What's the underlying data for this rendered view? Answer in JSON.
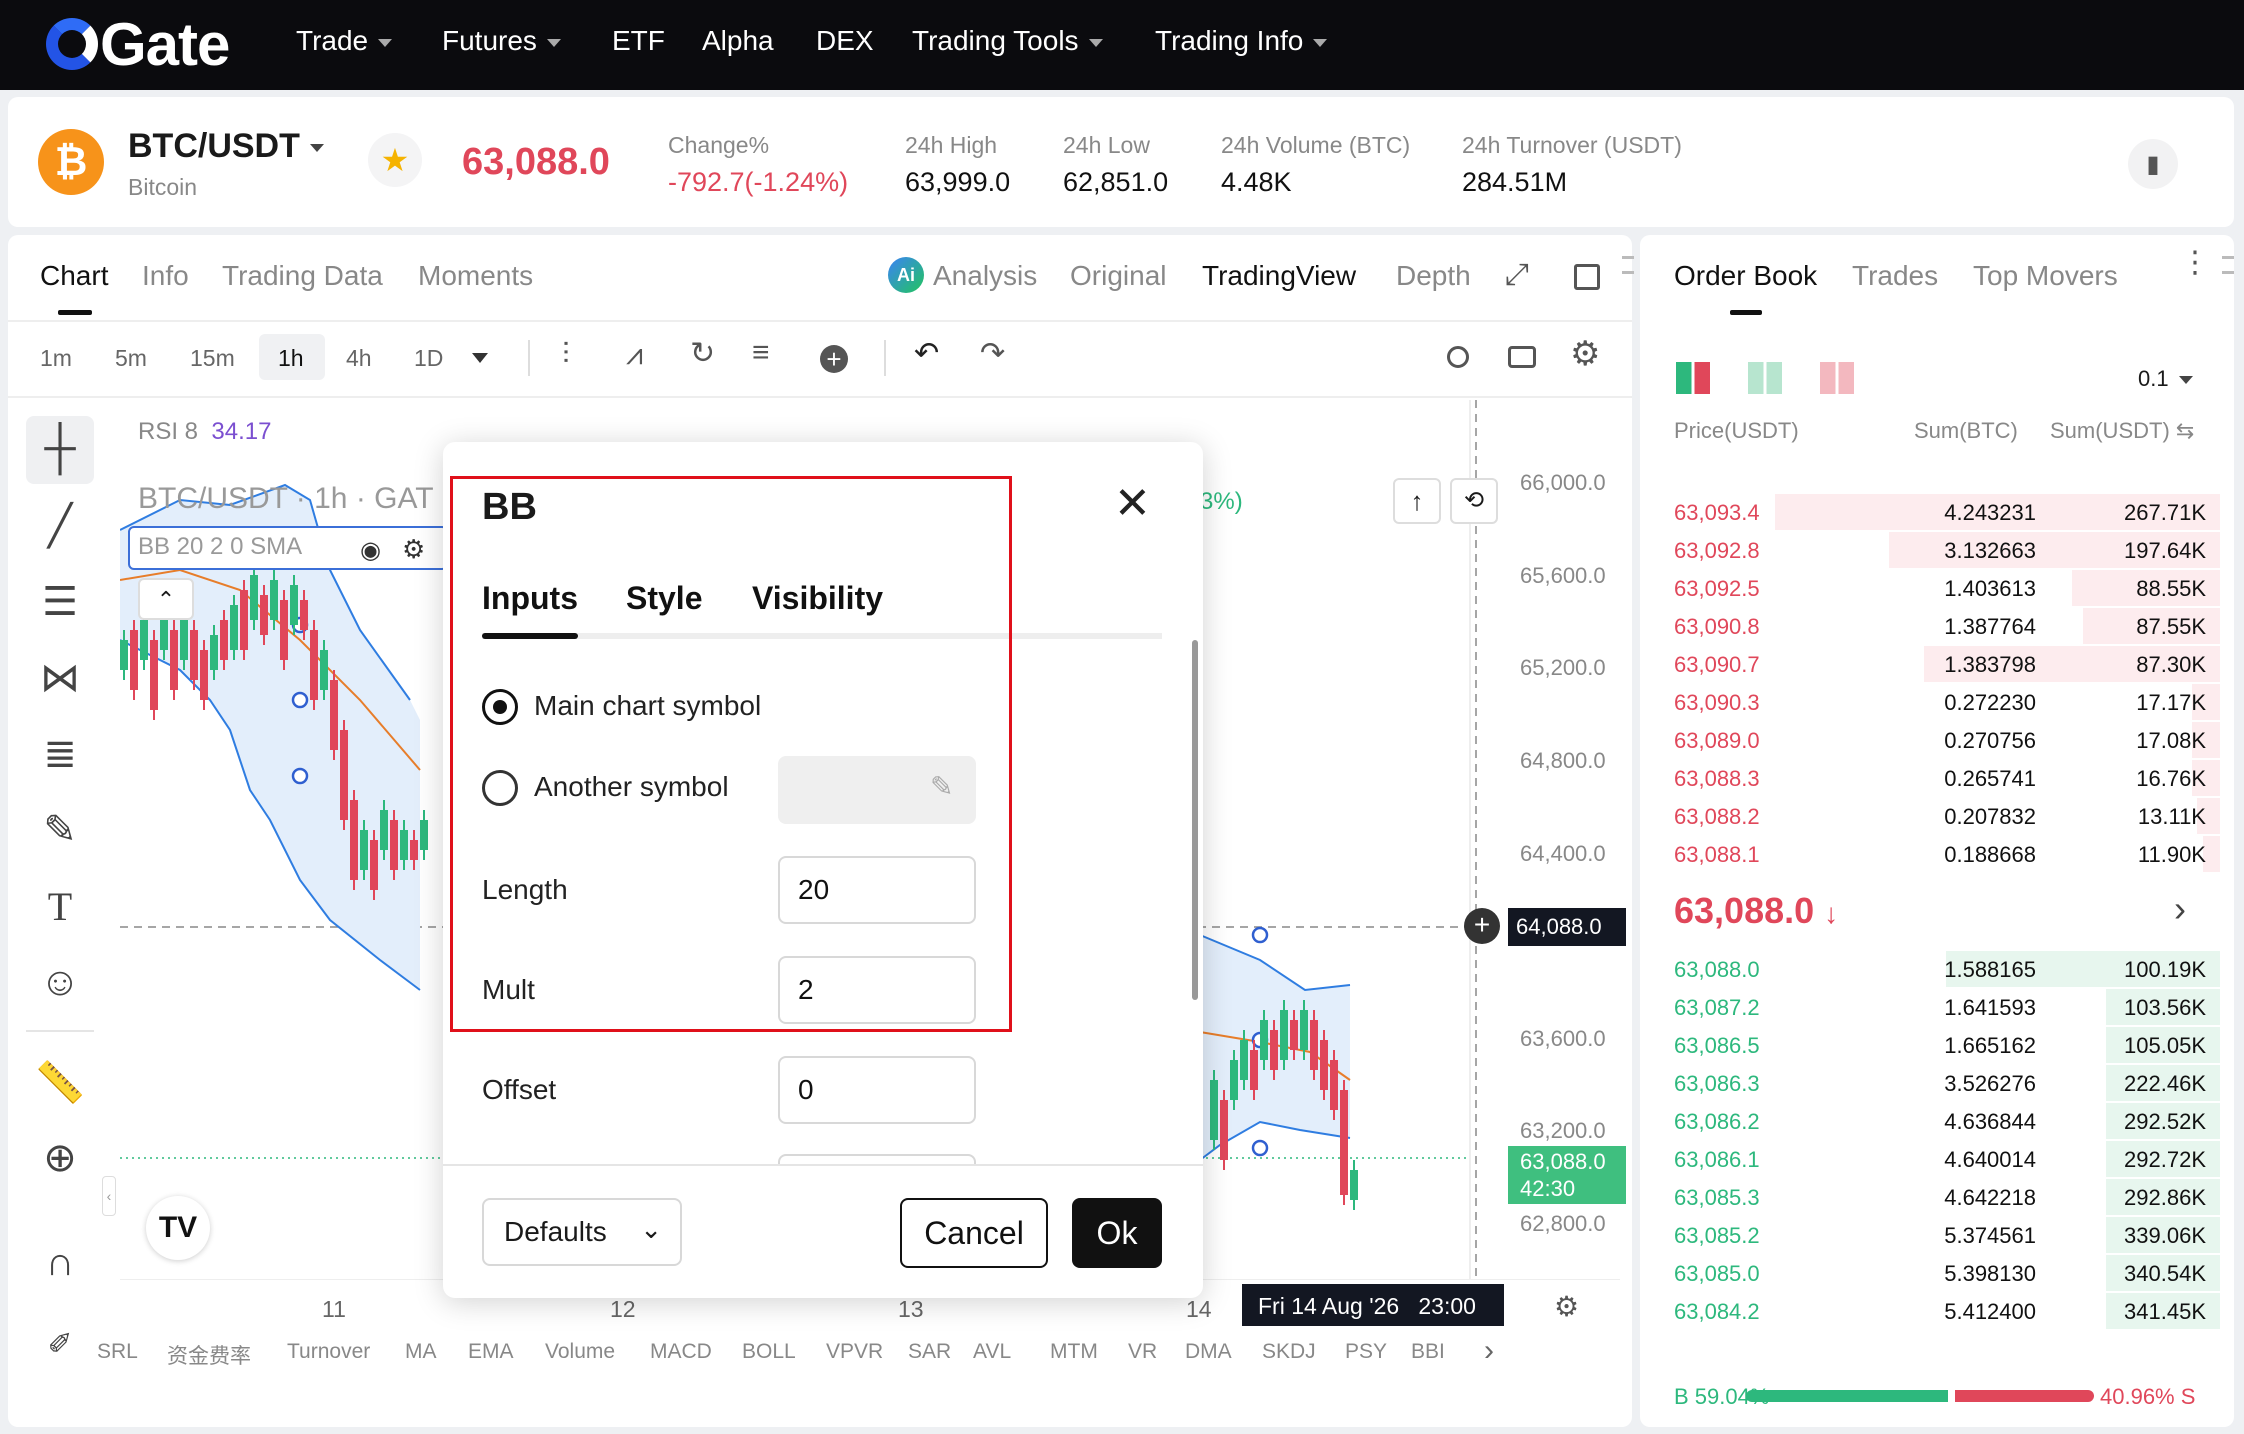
{
  "nav": {
    "logo": "Gate",
    "items": [
      {
        "label": "Trade",
        "caret": true
      },
      {
        "label": "Futures",
        "caret": true
      },
      {
        "label": "ETF",
        "caret": false
      },
      {
        "label": "Alpha",
        "caret": false
      },
      {
        "label": "DEX",
        "caret": false
      },
      {
        "label": "Trading Tools",
        "caret": true
      },
      {
        "label": "Trading Info",
        "caret": true
      }
    ]
  },
  "ticker": {
    "pair": "BTC/USDT",
    "name": "Bitcoin",
    "coin_symbol": "₿",
    "price": "63,088.0",
    "change_label": "Change%",
    "change_value": "-792.7(-1.24%)",
    "high_label": "24h High",
    "high_value": "63,999.0",
    "low_label": "24h Low",
    "low_value": "62,851.0",
    "volume_label": "24h Volume (BTC)",
    "volume_value": "4.48K",
    "turnover_label": "24h Turnover (USDT)",
    "turnover_value": "284.51M"
  },
  "chart_tabs": [
    "Chart",
    "Info",
    "Trading Data",
    "Moments"
  ],
  "view_tabs": {
    "analysis": "Analysis",
    "original": "Original",
    "tradingview": "TradingView",
    "depth": "Depth"
  },
  "timeframes": [
    "1m",
    "5m",
    "15m",
    "1h",
    "4h",
    "1D"
  ],
  "active_timeframe": "1h",
  "chart": {
    "rsi_label": "RSI 8",
    "rsi_value": "34.17",
    "symbol_line": "BTC/USDT · 1h · GAT",
    "bb_legend": "BB 20 2 0 SMA",
    "partial_pct": "3%)",
    "y_ticks": [
      "66,000.0",
      "65,600.0",
      "65,200.0",
      "64,800.0",
      "64,400.0",
      "63,600.0",
      "63,200.0",
      "62,800.0"
    ],
    "crosshair_price": "64,088.0",
    "last_price": "63,088.0",
    "countdown": "42:30",
    "x_ticks": [
      "11",
      "12",
      "13",
      "14"
    ],
    "crosshair_time": "Fri 14 Aug '26   23:00",
    "tv_logo": "TV"
  },
  "indicators": [
    "SRL",
    "资金费率",
    "Turnover",
    "MA",
    "EMA",
    "Volume",
    "MACD",
    "BOLL",
    "VPVR",
    "SAR",
    "AVL",
    "MTM",
    "VR",
    "DMA",
    "SKDJ",
    "PSY",
    "BBI"
  ],
  "dialog": {
    "title": "BB",
    "tabs": [
      "Inputs",
      "Style",
      "Visibility"
    ],
    "active_tab": "Inputs",
    "radio_main": "Main chart symbol",
    "radio_other": "Another symbol",
    "length_label": "Length",
    "length_value": "20",
    "mult_label": "Mult",
    "mult_value": "2",
    "offset_label": "Offset",
    "offset_value": "0",
    "defaults_label": "Defaults",
    "cancel_label": "Cancel",
    "ok_label": "Ok"
  },
  "orderbook": {
    "tabs": [
      "Order Book",
      "Trades",
      "Top Movers"
    ],
    "precision": "0.1",
    "headers": {
      "price": "Price(USDT)",
      "sum_btc": "Sum(BTC)",
      "sum_usdt": "Sum(USDT)"
    },
    "asks": [
      {
        "price": "63,093.4",
        "sum_btc": "4.243231",
        "sum_usdt": "267.71K",
        "depth": 0.78
      },
      {
        "price": "63,092.8",
        "sum_btc": "3.132663",
        "sum_usdt": "197.64K",
        "depth": 0.58
      },
      {
        "price": "63,092.5",
        "sum_btc": "1.403613",
        "sum_usdt": "88.55K",
        "depth": 0.26
      },
      {
        "price": "63,090.8",
        "sum_btc": "1.387764",
        "sum_usdt": "87.55K",
        "depth": 0.24
      },
      {
        "price": "63,090.7",
        "sum_btc": "1.383798",
        "sum_usdt": "87.30K",
        "depth": 0.52
      },
      {
        "price": "63,090.3",
        "sum_btc": "0.272230",
        "sum_usdt": "17.17K",
        "depth": 0.05
      },
      {
        "price": "63,089.0",
        "sum_btc": "0.270756",
        "sum_usdt": "17.08K",
        "depth": 0.05
      },
      {
        "price": "63,088.3",
        "sum_btc": "0.265741",
        "sum_usdt": "16.76K",
        "depth": 0.05
      },
      {
        "price": "63,088.2",
        "sum_btc": "0.207832",
        "sum_usdt": "13.11K",
        "depth": 0.04
      },
      {
        "price": "63,088.1",
        "sum_btc": "0.188668",
        "sum_usdt": "11.90K",
        "depth": 0.03
      }
    ],
    "mid_price": "63,088.0",
    "bids": [
      {
        "price": "63,088.0",
        "sum_btc": "1.588165",
        "sum_usdt": "100.19K",
        "depth": 0.48
      },
      {
        "price": "63,087.2",
        "sum_btc": "1.641593",
        "sum_usdt": "103.56K",
        "depth": 0.2
      },
      {
        "price": "63,086.5",
        "sum_btc": "1.665162",
        "sum_usdt": "105.05K",
        "depth": 0.2
      },
      {
        "price": "63,086.3",
        "sum_btc": "3.526276",
        "sum_usdt": "222.46K",
        "depth": 0.2
      },
      {
        "price": "63,086.2",
        "sum_btc": "4.636844",
        "sum_usdt": "292.52K",
        "depth": 0.2
      },
      {
        "price": "63,086.1",
        "sum_btc": "4.640014",
        "sum_usdt": "292.72K",
        "depth": 0.2
      },
      {
        "price": "63,085.3",
        "sum_btc": "4.642218",
        "sum_usdt": "292.86K",
        "depth": 0.2
      },
      {
        "price": "63,085.2",
        "sum_btc": "5.374561",
        "sum_usdt": "339.06K",
        "depth": 0.2
      },
      {
        "price": "63,085.0",
        "sum_btc": "5.398130",
        "sum_usdt": "340.54K",
        "depth": 0.2
      },
      {
        "price": "63,084.2",
        "sum_btc": "5.412400",
        "sum_usdt": "341.45K",
        "depth": 0.2
      }
    ],
    "buy_ratio": "B 59.04%",
    "sell_ratio": "40.96% S",
    "buy_fraction": 0.59
  },
  "colors": {
    "up": "#2db87d",
    "down": "#e0475a",
    "highlight": "#e0101a",
    "brand": "#2354e6"
  }
}
